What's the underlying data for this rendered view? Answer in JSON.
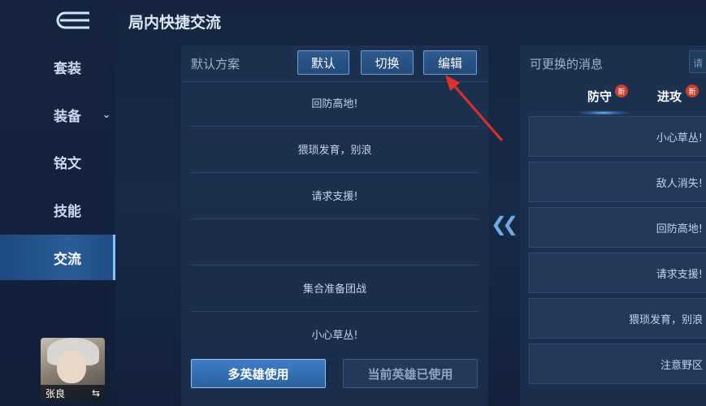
{
  "page": {
    "title": "局内快捷交流"
  },
  "sidebar": {
    "items": [
      {
        "label": "套装"
      },
      {
        "label": "装备"
      },
      {
        "label": "铭文"
      },
      {
        "label": "技能"
      },
      {
        "label": "交流"
      }
    ],
    "active": "交流",
    "hero": {
      "name": "张良",
      "swap_icon": "swap-arrows-icon"
    }
  },
  "left_panel": {
    "title": "默认方案",
    "buttons": {
      "default": "默认",
      "switch": "切换",
      "edit": "编辑"
    },
    "messages": [
      "回防高地!",
      "猥琐发育，别浪",
      "请求支援!",
      "",
      "集合准备团战",
      "小心草丛!"
    ],
    "multi_hero": "多英雄使用",
    "current_hero": "当前英雄已使用"
  },
  "right_panel": {
    "title": "可更换的消息",
    "search_placeholder": "请",
    "tabs": [
      {
        "label": "防守",
        "badge": "新"
      },
      {
        "label": "进攻",
        "badge": "新"
      }
    ],
    "messages": [
      "小心草丛!",
      "敌人消失!",
      "回防高地!",
      "请求支援!",
      "猥琐发育，别浪",
      "注意野区"
    ]
  },
  "colors": {
    "annotation_arrow": "#e0302b",
    "accent": "#6fa8e8"
  }
}
